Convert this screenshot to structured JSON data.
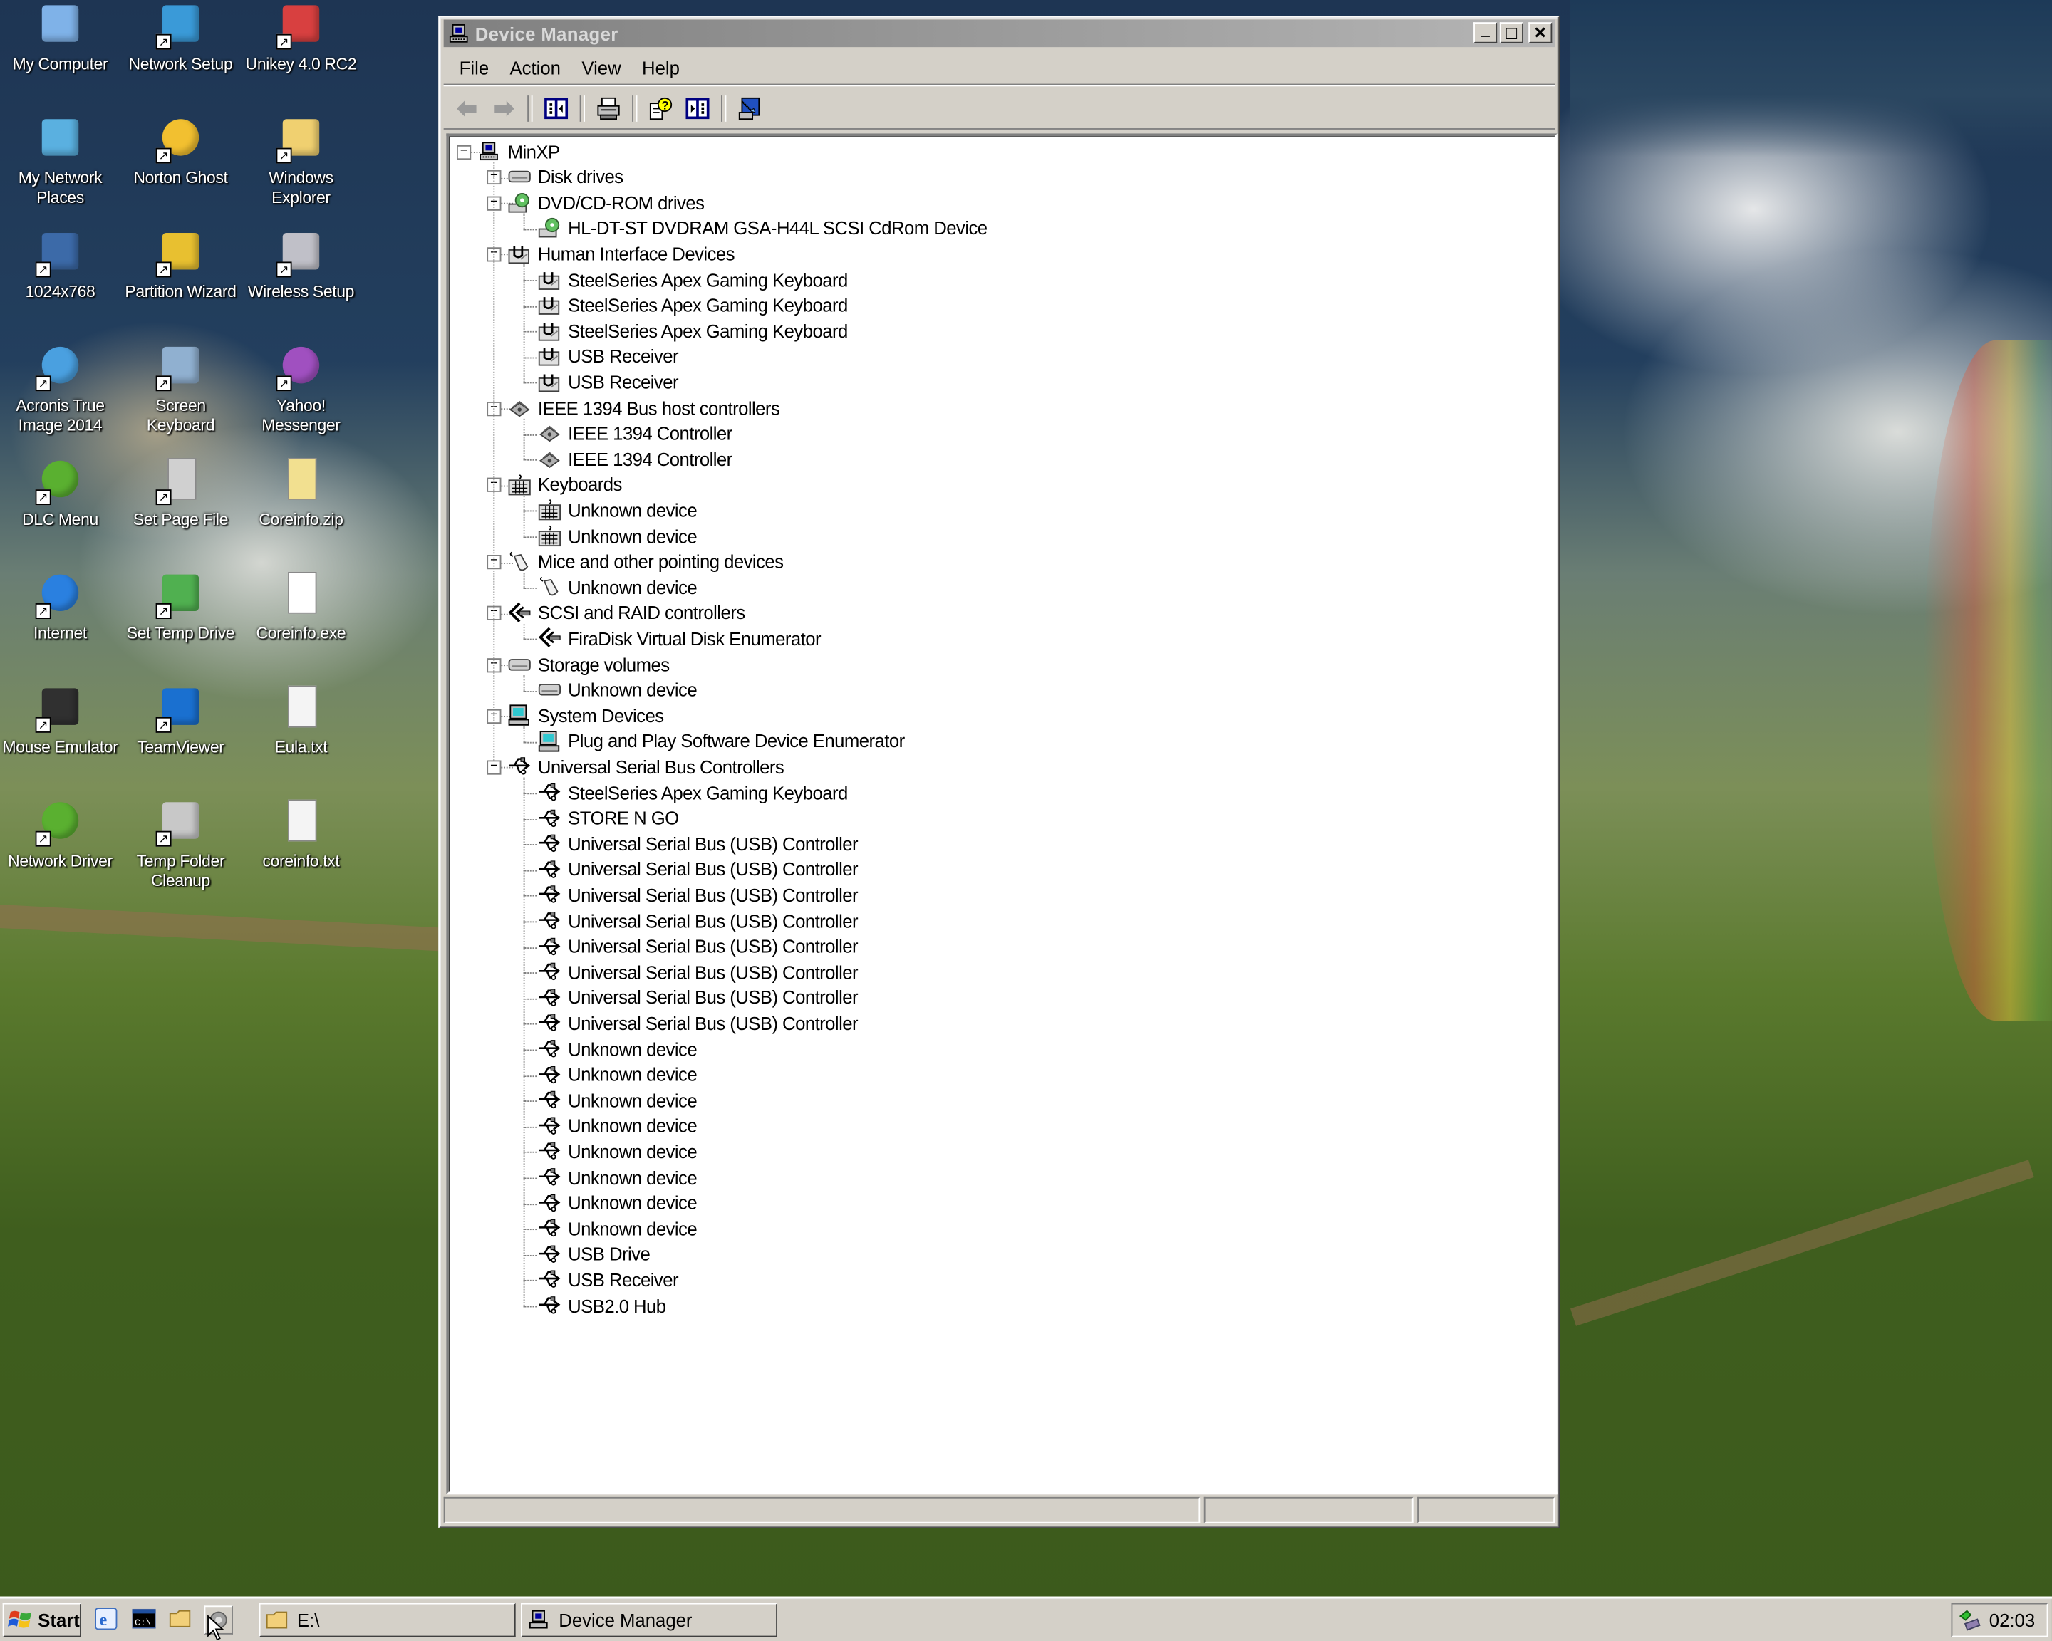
{
  "desktop": {
    "icons": [
      {
        "label": "My Computer",
        "icon": "my-computer-icon",
        "shortcut": false
      },
      {
        "label": "Network Setup",
        "icon": "network-setup-icon",
        "shortcut": true
      },
      {
        "label": "Unikey 4.0 RC2",
        "icon": "unikey-icon",
        "shortcut": true
      },
      {
        "label": "My Network Places",
        "icon": "network-places-icon",
        "shortcut": false
      },
      {
        "label": "Norton Ghost",
        "icon": "norton-ghost-icon",
        "shortcut": true
      },
      {
        "label": "Windows Explorer",
        "icon": "windows-explorer-icon",
        "shortcut": true
      },
      {
        "label": "1024x768",
        "icon": "display-resolution-icon",
        "shortcut": true
      },
      {
        "label": "Partition Wizard",
        "icon": "partition-wizard-icon",
        "shortcut": true
      },
      {
        "label": "Wireless Setup",
        "icon": "wireless-setup-icon",
        "shortcut": true
      },
      {
        "label": "Acronis True Image 2014",
        "icon": "acronis-icon",
        "shortcut": true
      },
      {
        "label": "Screen Keyboard",
        "icon": "screen-keyboard-icon",
        "shortcut": true
      },
      {
        "label": "Yahoo! Messenger",
        "icon": "yahoo-messenger-icon",
        "shortcut": true
      },
      {
        "label": "DLC Menu",
        "icon": "dlc-menu-icon",
        "shortcut": true
      },
      {
        "label": "Set Page File",
        "icon": "set-page-file-icon",
        "shortcut": true
      },
      {
        "label": "Coreinfo.zip",
        "icon": "zip-file-icon",
        "shortcut": false
      },
      {
        "label": "Internet",
        "icon": "internet-browser-icon",
        "shortcut": true
      },
      {
        "label": "Set Temp Drive",
        "icon": "set-temp-drive-icon",
        "shortcut": true
      },
      {
        "label": "Coreinfo.exe",
        "icon": "exe-file-icon",
        "shortcut": false
      },
      {
        "label": "Mouse Emulator",
        "icon": "mouse-emulator-icon",
        "shortcut": true
      },
      {
        "label": "TeamViewer",
        "icon": "teamviewer-icon",
        "shortcut": true
      },
      {
        "label": "Eula.txt",
        "icon": "text-file-icon",
        "shortcut": false
      },
      {
        "label": "Network Driver",
        "icon": "network-driver-icon",
        "shortcut": true
      },
      {
        "label": "Temp Folder Cleanup",
        "icon": "recycle-cleanup-icon",
        "shortcut": true
      },
      {
        "label": "coreinfo.txt",
        "icon": "text-file-icon",
        "shortcut": false
      }
    ]
  },
  "window": {
    "title": "Device Manager",
    "active": false,
    "controls": {
      "minimize": "_",
      "maximize": "□",
      "close": "✕"
    },
    "menu": [
      "File",
      "Action",
      "View",
      "Help"
    ],
    "toolbar": [
      "back",
      "forward",
      "show-hide-console-tree",
      "print",
      "help",
      "show-hide-action-pane",
      "properties"
    ],
    "tree": {
      "root": "MinXP",
      "categories": [
        {
          "label": "Disk drives",
          "icon": "disk-drive",
          "expanded": false,
          "children": []
        },
        {
          "label": "DVD/CD-ROM drives",
          "icon": "cdrom",
          "expanded": true,
          "children": [
            "HL-DT-ST DVDRAM GSA-H44L SCSI CdRom Device"
          ]
        },
        {
          "label": "Human Interface Devices",
          "icon": "hid",
          "expanded": true,
          "children": [
            "SteelSeries Apex Gaming Keyboard",
            "SteelSeries Apex Gaming Keyboard",
            "SteelSeries Apex Gaming Keyboard",
            "USB Receiver",
            "USB Receiver"
          ]
        },
        {
          "label": "IEEE 1394 Bus host controllers",
          "icon": "ieee1394",
          "expanded": true,
          "children": [
            "IEEE 1394 Controller",
            "IEEE 1394 Controller"
          ]
        },
        {
          "label": "Keyboards",
          "icon": "keyboard",
          "expanded": true,
          "children": [
            "Unknown device",
            "Unknown device"
          ]
        },
        {
          "label": "Mice and other pointing devices",
          "icon": "mouse",
          "expanded": true,
          "children": [
            "Unknown device"
          ]
        },
        {
          "label": "SCSI and RAID controllers",
          "icon": "scsi",
          "expanded": true,
          "children": [
            "FiraDisk Virtual Disk Enumerator"
          ]
        },
        {
          "label": "Storage volumes",
          "icon": "storage",
          "expanded": true,
          "children": [
            "Unknown device"
          ]
        },
        {
          "label": "System Devices",
          "icon": "system",
          "expanded": true,
          "children": [
            "Plug and Play Software Device Enumerator"
          ]
        },
        {
          "label": "Universal Serial Bus Controllers",
          "icon": "usb",
          "expanded": true,
          "children": [
            "SteelSeries Apex Gaming Keyboard",
            "STORE N GO",
            "Universal Serial Bus (USB) Controller",
            "Universal Serial Bus (USB) Controller",
            "Universal Serial Bus (USB) Controller",
            "Universal Serial Bus (USB) Controller",
            "Universal Serial Bus (USB) Controller",
            "Universal Serial Bus (USB) Controller",
            "Universal Serial Bus (USB) Controller",
            "Universal Serial Bus (USB) Controller",
            "Unknown device",
            "Unknown device",
            "Unknown device",
            "Unknown device",
            "Unknown device",
            "Unknown device",
            "Unknown device",
            "Unknown device",
            "USB Drive",
            "USB Receiver",
            "USB2.0 Hub"
          ]
        }
      ]
    },
    "statusbar": [
      "",
      "",
      ""
    ]
  },
  "taskbar": {
    "start_label": "Start",
    "quick_launch": [
      "internet-explorer-icon",
      "command-prompt-icon",
      "folder-icon",
      "device-icon"
    ],
    "tasks": [
      {
        "label": "E:\\",
        "icon": "folder-icon",
        "active": false
      },
      {
        "label": "Device Manager",
        "icon": "device-manager-icon",
        "active": false
      }
    ],
    "clock": "02:03"
  }
}
